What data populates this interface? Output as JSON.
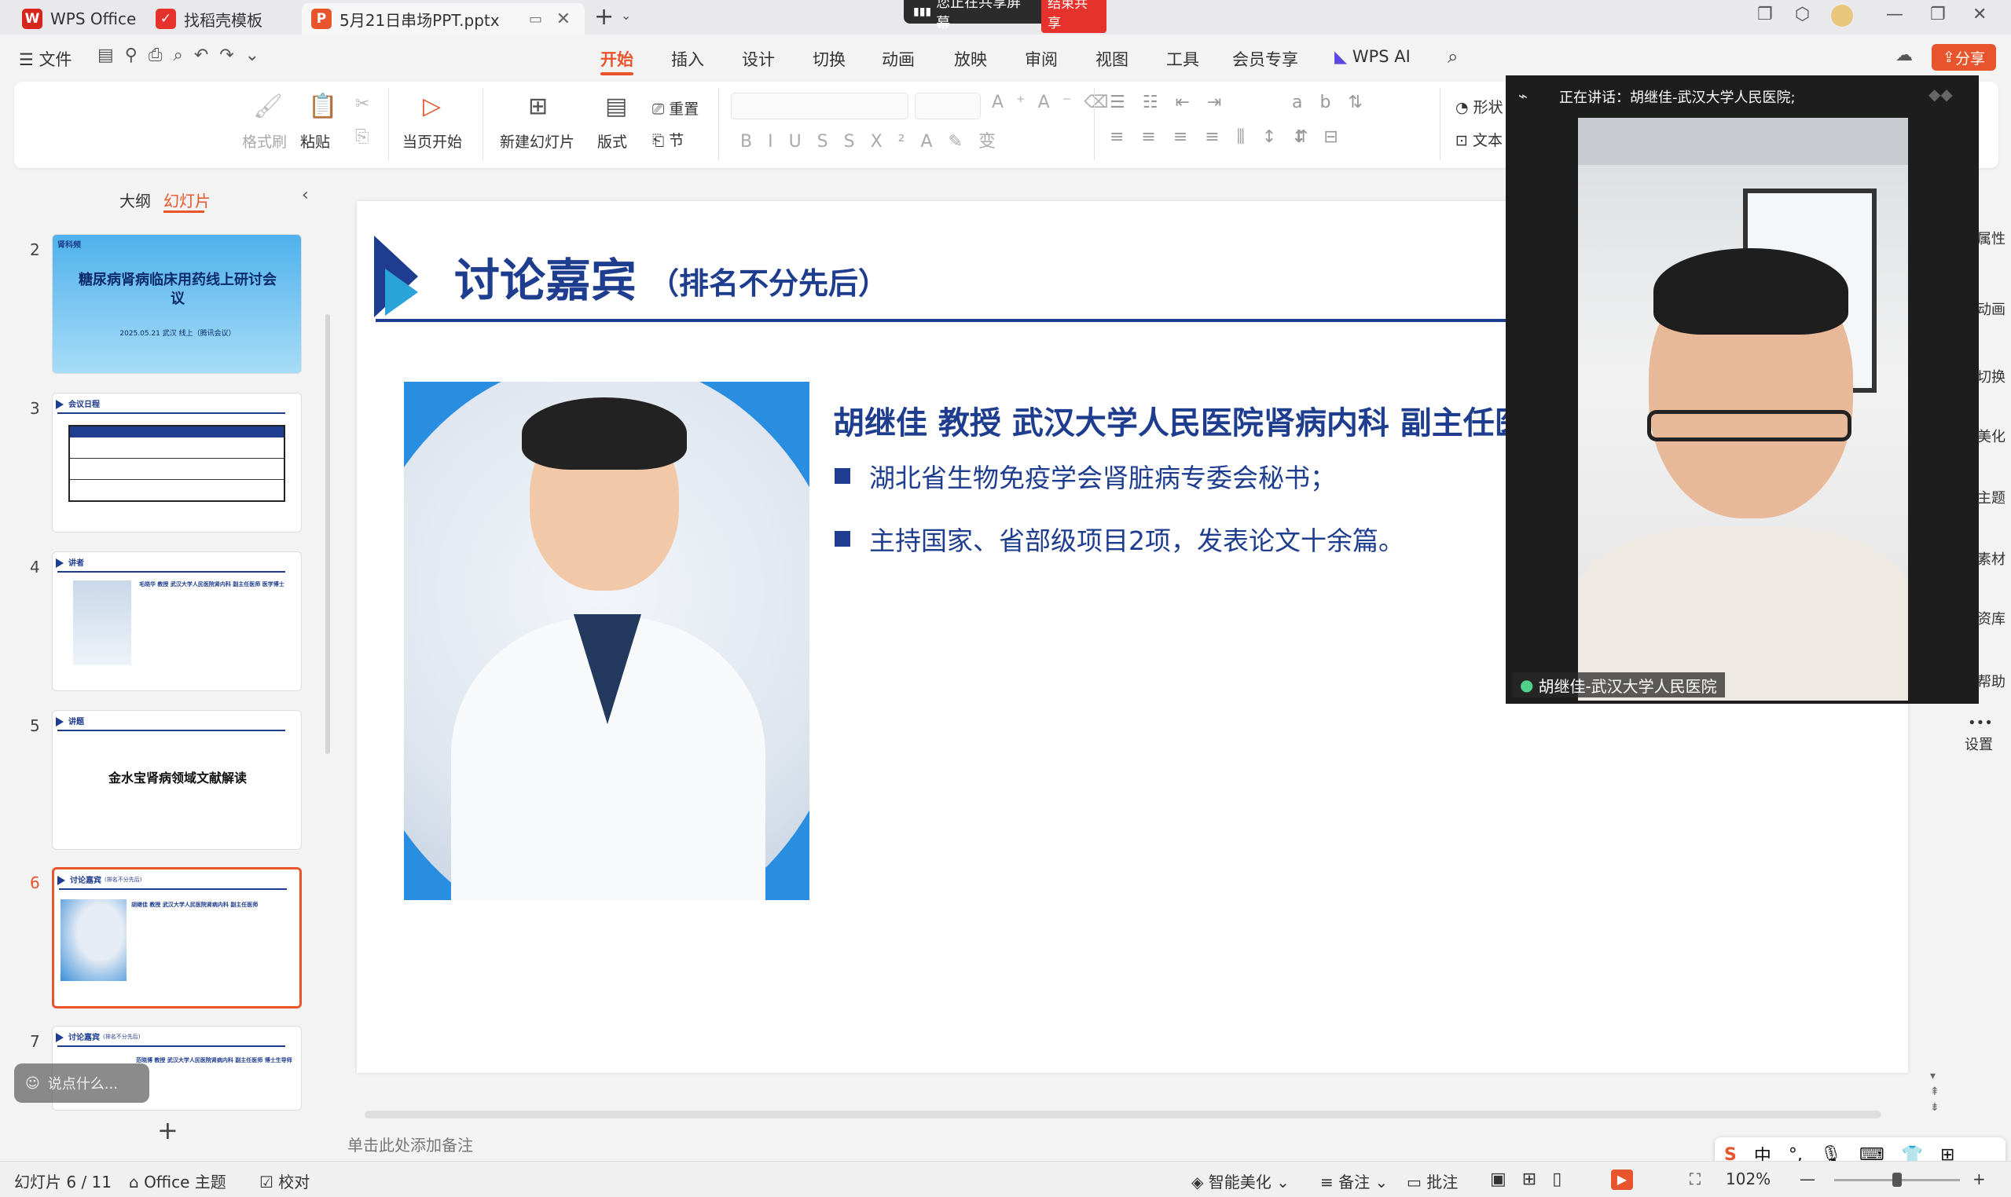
{
  "tabs": [
    {
      "label": "WPS Office",
      "color": "#d7261e"
    },
    {
      "label": "找稻壳模板",
      "color": "#e5322d"
    },
    {
      "label": "5月21日串场PPT.pptx",
      "color": "#e8542b"
    }
  ],
  "share_banner": {
    "text": "您正在共享屏幕",
    "end_label": "结束共享"
  },
  "file_menu": "文件",
  "menus": [
    "开始",
    "插入",
    "设计",
    "切换",
    "动画",
    "放映",
    "审阅",
    "视图",
    "工具",
    "会员专享",
    "WPS AI"
  ],
  "share_button": "分享",
  "ribbon": {
    "format_painter": "格式刷",
    "paste": "粘贴",
    "play_from_current": "当页开始",
    "new_slide": "新建幻灯片",
    "layout": "版式",
    "reset": "重置",
    "section": "节",
    "shape": "形状",
    "textbox": "文本"
  },
  "panel": {
    "outline_tab": "大纲",
    "slides_tab": "幻灯片"
  },
  "thumbs": [
    {
      "num": "2",
      "brand": "肾科频",
      "title": "糖尿病肾病临床用药线上研讨会议",
      "sub": "2025.05.21  武汉  线上（腾讯会议）"
    },
    {
      "num": "3",
      "heading": "会议日程"
    },
    {
      "num": "4",
      "heading": "讲者",
      "text": "毛晓华 教授 武汉大学人民医院肾内科 副主任医师 医学博士"
    },
    {
      "num": "5",
      "heading": "讲题",
      "title": "金水宝肾病领域文献解读"
    },
    {
      "num": "6",
      "heading": "讨论嘉宾",
      "sub": "(排名不分先后)",
      "text": "胡继佳 教授 武汉大学人民医院肾病内科 副主任医师"
    },
    {
      "num": "7",
      "heading": "讨论嘉宾",
      "sub": "(排名不分先后)",
      "text": "范晓博 教授 武汉大学人民医院肾病内科 副主任医师 博士生导师"
    }
  ],
  "chat_placeholder": "说点什么...",
  "slide": {
    "title": "讨论嘉宾",
    "subtitle": "（排名不分先后）",
    "name_line": "胡继佳  教授  武汉大学人民医院肾病内科  副主任医师",
    "bullets": [
      "湖北省生物免疫学会肾脏病专委会秘书；",
      "主持国家、省部级项目2项，发表论文十余篇。"
    ],
    "accent": "#1e3d8f",
    "accent2": "#2aa3d8"
  },
  "notes_placeholder": "单击此处添加备注",
  "video": {
    "speaking_label": "正在讲话：胡继佳-武汉大学人民医院;",
    "name_tag": "胡继佳-武汉大学人民医院"
  },
  "right_tools": [
    "属性",
    "动画",
    "切换",
    "美化",
    "主题",
    "素材",
    "资库",
    "帮助",
    "设置"
  ],
  "status": {
    "slide_counter": "幻灯片 6 / 11",
    "theme": "Office 主题",
    "proof": "校对",
    "beautify": "智能美化",
    "notes": "备注",
    "comment": "批注",
    "zoom": "102%"
  },
  "ime": [
    "中",
    "°,"
  ]
}
